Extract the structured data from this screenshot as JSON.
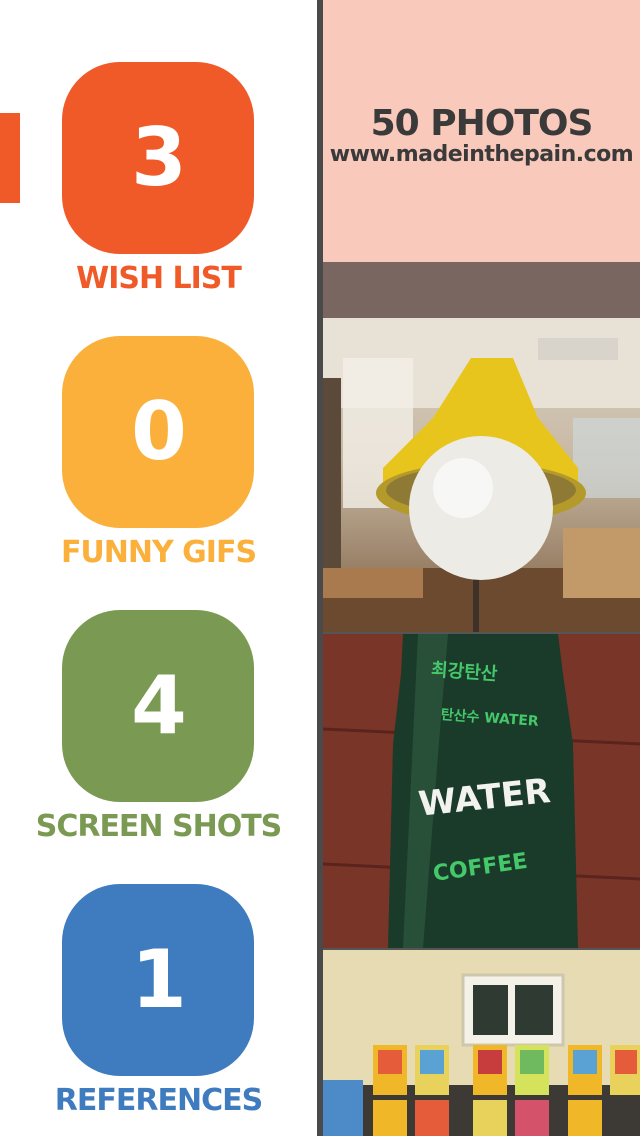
{
  "albums": [
    {
      "count": "3",
      "label": "WISH LIST",
      "color": "#f05a28",
      "selected": true
    },
    {
      "count": "0",
      "label": "FUNNY GIFS",
      "color": "#fbb03b"
    },
    {
      "count": "4",
      "label": "SCREEN SHOTS",
      "color": "#7a9a53"
    },
    {
      "count": "1",
      "label": "REFERENCES",
      "color": "#3f7cbf"
    }
  ],
  "header": {
    "photo_count": "50 PHOTOS",
    "url": "www.madeinthepain.com"
  },
  "photos": [
    {
      "name": "lamp-photo",
      "bottle_text": ""
    },
    {
      "name": "bottle-photo",
      "bottle_text": "WATER",
      "sub_text": "COFFEE"
    },
    {
      "name": "shelves-photo"
    }
  ],
  "colors": {
    "selected_indicator": "#f05a28",
    "divider": "#4a4a4a",
    "header_bg": "#f9c9bb"
  }
}
